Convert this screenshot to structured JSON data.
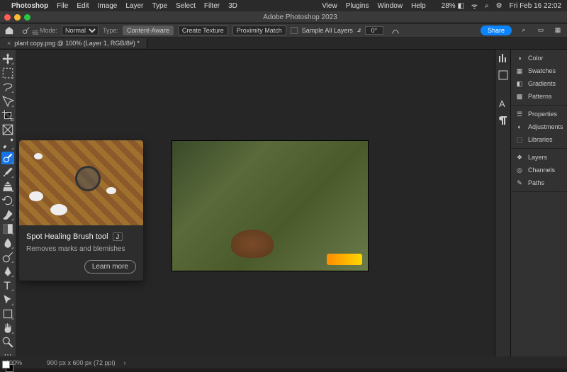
{
  "mac": {
    "app": "Photoshop",
    "menus": [
      "File",
      "Edit",
      "Image",
      "Layer",
      "Type",
      "Select",
      "Filter",
      "3D",
      "View",
      "Plugins",
      "Window",
      "Help"
    ],
    "battery": "28%",
    "clock": "Fri Feb 16  22:02"
  },
  "titlebar": {
    "title": "Adobe Photoshop 2023"
  },
  "options": {
    "brush_size": "65",
    "mode_label": "Mode:",
    "mode_value": "Normal",
    "type_label": "Type:",
    "buttons": {
      "content_aware": "Content-Aware",
      "create_texture": "Create Texture",
      "proximity": "Proximity Match"
    },
    "sample_all": "Sample All Layers",
    "angle_sym": "⦨",
    "angle": "0°",
    "share": "Share"
  },
  "doctab": {
    "name": "plant copy.png @ 100% (Layer 1, RGB/8#) *"
  },
  "popover": {
    "title": "Spot Healing Brush tool",
    "key": "J",
    "desc": "Removes marks and blemishes",
    "learn": "Learn more"
  },
  "right": {
    "groupA": [
      "Color",
      "Swatches",
      "Gradients",
      "Patterns"
    ],
    "groupB": [
      "Properties",
      "Adjustments",
      "Libraries"
    ],
    "groupC": [
      "Layers",
      "Channels",
      "Paths"
    ]
  },
  "status": {
    "zoom": "100%",
    "dims": "900 px x 600 px (72 ppi)"
  }
}
